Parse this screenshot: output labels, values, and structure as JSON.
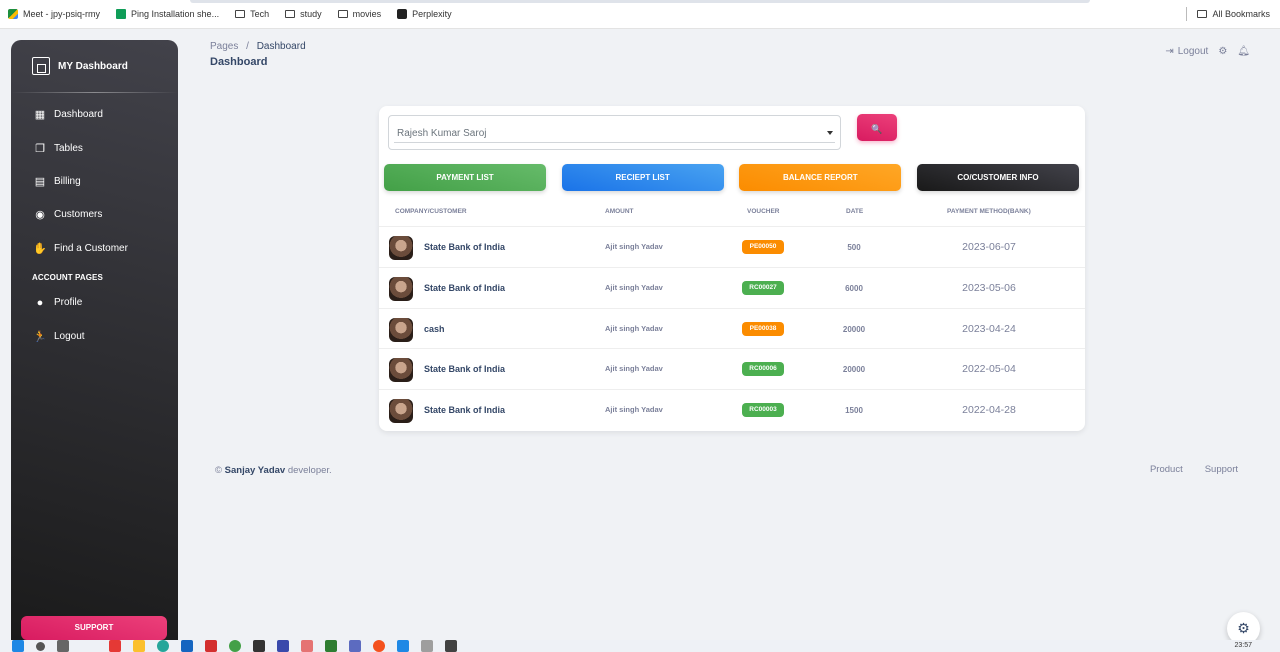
{
  "bookmarks": {
    "items": [
      {
        "label": "Meet - jpy-psiq-rmy",
        "icon": "meet-icon"
      },
      {
        "label": "Ping Installation she...",
        "icon": "sheets-icon"
      },
      {
        "label": "Tech",
        "icon": "folder-icon"
      },
      {
        "label": "study",
        "icon": "folder-icon"
      },
      {
        "label": "movies",
        "icon": "folder-icon"
      },
      {
        "label": "Perplexity",
        "icon": "perplexity-icon"
      }
    ],
    "all_bookmarks": "All Bookmarks"
  },
  "sidebar": {
    "brand": "MY Dashboard",
    "items": [
      {
        "label": "Dashboard",
        "icon": "dashboard-icon",
        "glyph": "▦"
      },
      {
        "label": "Tables",
        "icon": "tables-icon",
        "glyph": "❐"
      },
      {
        "label": "Billing",
        "icon": "billing-icon",
        "glyph": "▤"
      },
      {
        "label": "Customers",
        "icon": "customers-icon",
        "glyph": "◉"
      },
      {
        "label": "Find a Customer",
        "icon": "find-customer-icon",
        "glyph": "✋"
      }
    ],
    "section_heading": "ACCOUNT PAGES",
    "account_items": [
      {
        "label": "Profile",
        "icon": "profile-icon",
        "glyph": "●"
      },
      {
        "label": "Logout",
        "icon": "logout-run-icon",
        "glyph": "🏃"
      }
    ],
    "support": "SUPPORT"
  },
  "header": {
    "breadcrumb_root": "Pages",
    "breadcrumb_sep": "/",
    "breadcrumb_current": "Dashboard",
    "title": "Dashboard",
    "logout": "Logout"
  },
  "search": {
    "selected": "Rajesh Kumar Saroj",
    "button_glyph": "🔍"
  },
  "buttons": [
    {
      "label": "PAYMENT LIST",
      "color": "#4caf50"
    },
    {
      "label": "RECIEPT LIST",
      "color": "#1a73e8"
    },
    {
      "label": "BALANCE REPORT",
      "color": "#fb8c00"
    },
    {
      "label": "CO/CUSTOMER INFO",
      "color": "#262626"
    }
  ],
  "table": {
    "headers": [
      "COMPANY/CUSTOMER",
      "AMOUNT",
      "VOUCHER",
      "DATE",
      "PAYMENT METHOD(BANK)"
    ],
    "rows": [
      {
        "company": "State Bank of India",
        "amount": "Ajit singh Yadav",
        "voucher": "PE00050",
        "voucher_color": "#fb8c00",
        "date": "500",
        "method": "2023-06-07"
      },
      {
        "company": "State Bank of India",
        "amount": "Ajit singh Yadav",
        "voucher": "RC00027",
        "voucher_color": "#4caf50",
        "date": "6000",
        "method": "2023-05-06"
      },
      {
        "company": "cash",
        "amount": "Ajit singh Yadav",
        "voucher": "PE00038",
        "voucher_color": "#fb8c00",
        "date": "20000",
        "method": "2023-04-24"
      },
      {
        "company": "State Bank of India",
        "amount": "Ajit singh Yadav",
        "voucher": "RC00006",
        "voucher_color": "#4caf50",
        "date": "20000",
        "method": "2022-05-04"
      },
      {
        "company": "State Bank of India",
        "amount": "Ajit singh Yadav",
        "voucher": "RC00003",
        "voucher_color": "#4caf50",
        "date": "1500",
        "method": "2022-04-28"
      }
    ]
  },
  "footer": {
    "copyright": "©",
    "author": "Sanjay Yadav",
    "suffix": "developer.",
    "links": [
      "Product",
      "Support"
    ]
  },
  "taskbar": {
    "clock": "23:57"
  }
}
